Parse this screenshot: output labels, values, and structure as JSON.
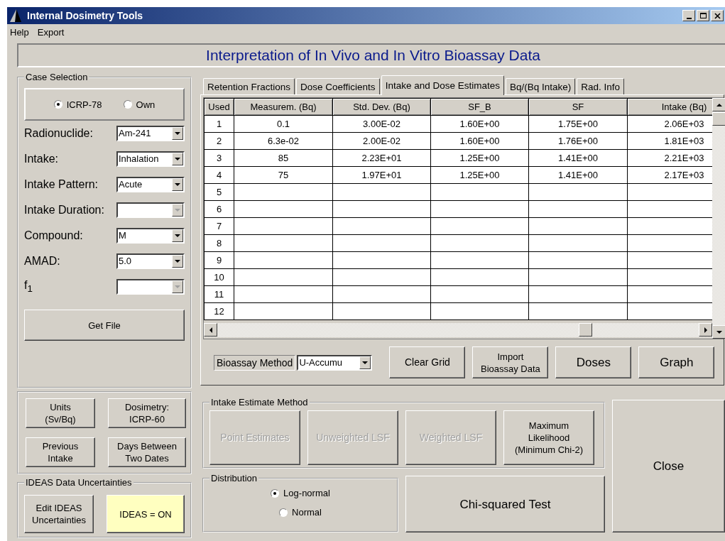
{
  "window": {
    "title": "Internal Dosimetry Tools"
  },
  "menu": [
    "Help",
    "Export"
  ],
  "banner": "Interpretation of In Vivo and In Vitro Bioassay Data",
  "case_selection": {
    "title": "Case Selection",
    "options": [
      {
        "label": "ICRP-78",
        "selected": true
      },
      {
        "label": "Own",
        "selected": false
      }
    ],
    "fields": [
      {
        "label": "Radionuclide:",
        "value": "Am-241",
        "disabled": false
      },
      {
        "label": "Intake:",
        "value": "Inhalation",
        "disabled": false
      },
      {
        "label": "Intake Pattern:",
        "value": "Acute",
        "disabled": false
      },
      {
        "label": "Intake Duration:",
        "disabled": true
      },
      {
        "label": "Compound:",
        "value": "M",
        "disabled": false
      },
      {
        "label": "AMAD:",
        "value": "5.0",
        "disabled": false
      },
      {
        "label": "f$_{1}$",
        "disabled": true
      }
    ],
    "get_file": "Get File"
  },
  "settings_buttons": [
    "Units\n(Sv/Bq)",
    "Dosimetry:\nICRP-60",
    "Previous\nIntake",
    "Days Between\nTwo Dates"
  ],
  "ideas": {
    "title": "IDEAS Data Uncertainties",
    "edit_button": "Edit IDEAS\nUncertainties",
    "toggle": {
      "label": "IDEAS = ON",
      "on": true
    }
  },
  "tabs": [
    {
      "label": "Retention Fractions",
      "selected": false
    },
    {
      "label": "Dose Coefficients",
      "selected": false
    },
    {
      "label": "Intake and Dose Estimates",
      "selected": true
    },
    {
      "label": "Bq/(Bq Intake)",
      "selected": false
    },
    {
      "label": "Rad. Info",
      "selected": false
    }
  ],
  "table": {
    "columns": [
      "Used",
      "Measurem. (Bq)",
      "Std. Dev. (Bq)",
      "SF_B",
      "SF",
      "Intake (Bq)"
    ],
    "rows": [
      [
        "1",
        "0.1",
        "3.00E-02",
        "1.60E+00",
        "1.75E+00",
        "2.06E+03"
      ],
      [
        "2",
        "6.3e-02",
        "2.00E-02",
        "1.60E+00",
        "1.76E+00",
        "1.81E+03"
      ],
      [
        "3",
        "85",
        "2.23E+01",
        "1.25E+00",
        "1.41E+00",
        "2.21E+03"
      ],
      [
        "4",
        "75",
        "1.97E+01",
        "1.25E+00",
        "1.41E+00",
        "2.17E+03"
      ],
      [
        "5"
      ],
      [
        "6"
      ],
      [
        "7"
      ],
      [
        "8"
      ],
      [
        "9"
      ],
      [
        "10"
      ],
      [
        "11"
      ],
      [
        "12"
      ]
    ]
  },
  "bioassay": {
    "label": "Bioassay Method",
    "value": "U-Accumu"
  },
  "grid_buttons": [
    "Clear Grid",
    "Import\nBioassay Data",
    "Doses",
    "Graph"
  ],
  "intake_method": {
    "title": "Intake Estimate Method",
    "buttons": [
      {
        "label": "Point Estimates",
        "disabled": true
      },
      {
        "label": "Unweighted LSF",
        "disabled": true
      },
      {
        "label": "Weighted LSF",
        "disabled": true
      },
      {
        "label": "Maximum\nLikelihood\n(Minimum Chi-2)",
        "disabled": false
      }
    ]
  },
  "distribution": {
    "title": "Distribution",
    "options": [
      {
        "label": "Log-normal",
        "selected": true
      },
      {
        "label": "Normal",
        "selected": false
      }
    ]
  },
  "chi_squared_button": "Chi-squared Test",
  "close_button": "Close"
}
